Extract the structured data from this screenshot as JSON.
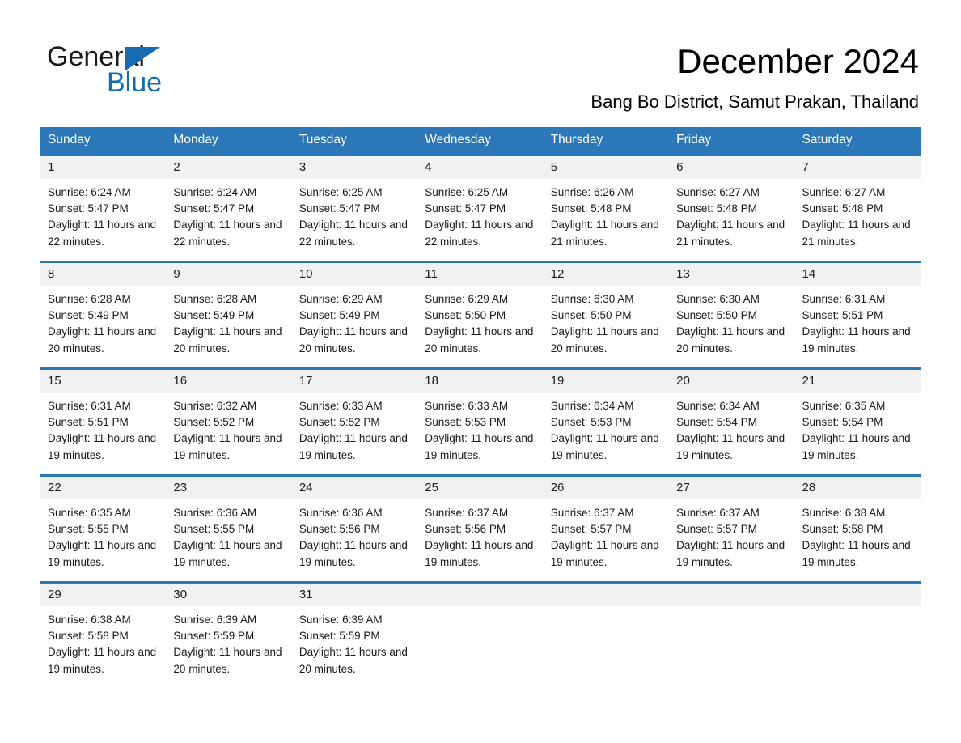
{
  "brand": {
    "name_part1": "General",
    "name_part2": "Blue",
    "logo_icon": "triangle-flag-icon",
    "accent_color": "#1769b0"
  },
  "header": {
    "title": "December 2024",
    "subtitle": "Bang Bo District, Samut Prakan, Thailand"
  },
  "calendar": {
    "header_background": "#2b77b8",
    "header_text_color": "#ffffff",
    "daynum_background": "#f1f1f1",
    "weekdays": [
      "Sunday",
      "Monday",
      "Tuesday",
      "Wednesday",
      "Thursday",
      "Friday",
      "Saturday"
    ],
    "weeks": [
      [
        {
          "day": "1",
          "sunrise": "Sunrise: 6:24 AM",
          "sunset": "Sunset: 5:47 PM",
          "daylight": "Daylight: 11 hours and 22 minutes."
        },
        {
          "day": "2",
          "sunrise": "Sunrise: 6:24 AM",
          "sunset": "Sunset: 5:47 PM",
          "daylight": "Daylight: 11 hours and 22 minutes."
        },
        {
          "day": "3",
          "sunrise": "Sunrise: 6:25 AM",
          "sunset": "Sunset: 5:47 PM",
          "daylight": "Daylight: 11 hours and 22 minutes."
        },
        {
          "day": "4",
          "sunrise": "Sunrise: 6:25 AM",
          "sunset": "Sunset: 5:47 PM",
          "daylight": "Daylight: 11 hours and 22 minutes."
        },
        {
          "day": "5",
          "sunrise": "Sunrise: 6:26 AM",
          "sunset": "Sunset: 5:48 PM",
          "daylight": "Daylight: 11 hours and 21 minutes."
        },
        {
          "day": "6",
          "sunrise": "Sunrise: 6:27 AM",
          "sunset": "Sunset: 5:48 PM",
          "daylight": "Daylight: 11 hours and 21 minutes."
        },
        {
          "day": "7",
          "sunrise": "Sunrise: 6:27 AM",
          "sunset": "Sunset: 5:48 PM",
          "daylight": "Daylight: 11 hours and 21 minutes."
        }
      ],
      [
        {
          "day": "8",
          "sunrise": "Sunrise: 6:28 AM",
          "sunset": "Sunset: 5:49 PM",
          "daylight": "Daylight: 11 hours and 20 minutes."
        },
        {
          "day": "9",
          "sunrise": "Sunrise: 6:28 AM",
          "sunset": "Sunset: 5:49 PM",
          "daylight": "Daylight: 11 hours and 20 minutes."
        },
        {
          "day": "10",
          "sunrise": "Sunrise: 6:29 AM",
          "sunset": "Sunset: 5:49 PM",
          "daylight": "Daylight: 11 hours and 20 minutes."
        },
        {
          "day": "11",
          "sunrise": "Sunrise: 6:29 AM",
          "sunset": "Sunset: 5:50 PM",
          "daylight": "Daylight: 11 hours and 20 minutes."
        },
        {
          "day": "12",
          "sunrise": "Sunrise: 6:30 AM",
          "sunset": "Sunset: 5:50 PM",
          "daylight": "Daylight: 11 hours and 20 minutes."
        },
        {
          "day": "13",
          "sunrise": "Sunrise: 6:30 AM",
          "sunset": "Sunset: 5:50 PM",
          "daylight": "Daylight: 11 hours and 20 minutes."
        },
        {
          "day": "14",
          "sunrise": "Sunrise: 6:31 AM",
          "sunset": "Sunset: 5:51 PM",
          "daylight": "Daylight: 11 hours and 19 minutes."
        }
      ],
      [
        {
          "day": "15",
          "sunrise": "Sunrise: 6:31 AM",
          "sunset": "Sunset: 5:51 PM",
          "daylight": "Daylight: 11 hours and 19 minutes."
        },
        {
          "day": "16",
          "sunrise": "Sunrise: 6:32 AM",
          "sunset": "Sunset: 5:52 PM",
          "daylight": "Daylight: 11 hours and 19 minutes."
        },
        {
          "day": "17",
          "sunrise": "Sunrise: 6:33 AM",
          "sunset": "Sunset: 5:52 PM",
          "daylight": "Daylight: 11 hours and 19 minutes."
        },
        {
          "day": "18",
          "sunrise": "Sunrise: 6:33 AM",
          "sunset": "Sunset: 5:53 PM",
          "daylight": "Daylight: 11 hours and 19 minutes."
        },
        {
          "day": "19",
          "sunrise": "Sunrise: 6:34 AM",
          "sunset": "Sunset: 5:53 PM",
          "daylight": "Daylight: 11 hours and 19 minutes."
        },
        {
          "day": "20",
          "sunrise": "Sunrise: 6:34 AM",
          "sunset": "Sunset: 5:54 PM",
          "daylight": "Daylight: 11 hours and 19 minutes."
        },
        {
          "day": "21",
          "sunrise": "Sunrise: 6:35 AM",
          "sunset": "Sunset: 5:54 PM",
          "daylight": "Daylight: 11 hours and 19 minutes."
        }
      ],
      [
        {
          "day": "22",
          "sunrise": "Sunrise: 6:35 AM",
          "sunset": "Sunset: 5:55 PM",
          "daylight": "Daylight: 11 hours and 19 minutes."
        },
        {
          "day": "23",
          "sunrise": "Sunrise: 6:36 AM",
          "sunset": "Sunset: 5:55 PM",
          "daylight": "Daylight: 11 hours and 19 minutes."
        },
        {
          "day": "24",
          "sunrise": "Sunrise: 6:36 AM",
          "sunset": "Sunset: 5:56 PM",
          "daylight": "Daylight: 11 hours and 19 minutes."
        },
        {
          "day": "25",
          "sunrise": "Sunrise: 6:37 AM",
          "sunset": "Sunset: 5:56 PM",
          "daylight": "Daylight: 11 hours and 19 minutes."
        },
        {
          "day": "26",
          "sunrise": "Sunrise: 6:37 AM",
          "sunset": "Sunset: 5:57 PM",
          "daylight": "Daylight: 11 hours and 19 minutes."
        },
        {
          "day": "27",
          "sunrise": "Sunrise: 6:37 AM",
          "sunset": "Sunset: 5:57 PM",
          "daylight": "Daylight: 11 hours and 19 minutes."
        },
        {
          "day": "28",
          "sunrise": "Sunrise: 6:38 AM",
          "sunset": "Sunset: 5:58 PM",
          "daylight": "Daylight: 11 hours and 19 minutes."
        }
      ],
      [
        {
          "day": "29",
          "sunrise": "Sunrise: 6:38 AM",
          "sunset": "Sunset: 5:58 PM",
          "daylight": "Daylight: 11 hours and 19 minutes."
        },
        {
          "day": "30",
          "sunrise": "Sunrise: 6:39 AM",
          "sunset": "Sunset: 5:59 PM",
          "daylight": "Daylight: 11 hours and 20 minutes."
        },
        {
          "day": "31",
          "sunrise": "Sunrise: 6:39 AM",
          "sunset": "Sunset: 5:59 PM",
          "daylight": "Daylight: 11 hours and 20 minutes."
        },
        {
          "day": "",
          "sunrise": "",
          "sunset": "",
          "daylight": ""
        },
        {
          "day": "",
          "sunrise": "",
          "sunset": "",
          "daylight": ""
        },
        {
          "day": "",
          "sunrise": "",
          "sunset": "",
          "daylight": ""
        },
        {
          "day": "",
          "sunrise": "",
          "sunset": "",
          "daylight": ""
        }
      ]
    ]
  }
}
